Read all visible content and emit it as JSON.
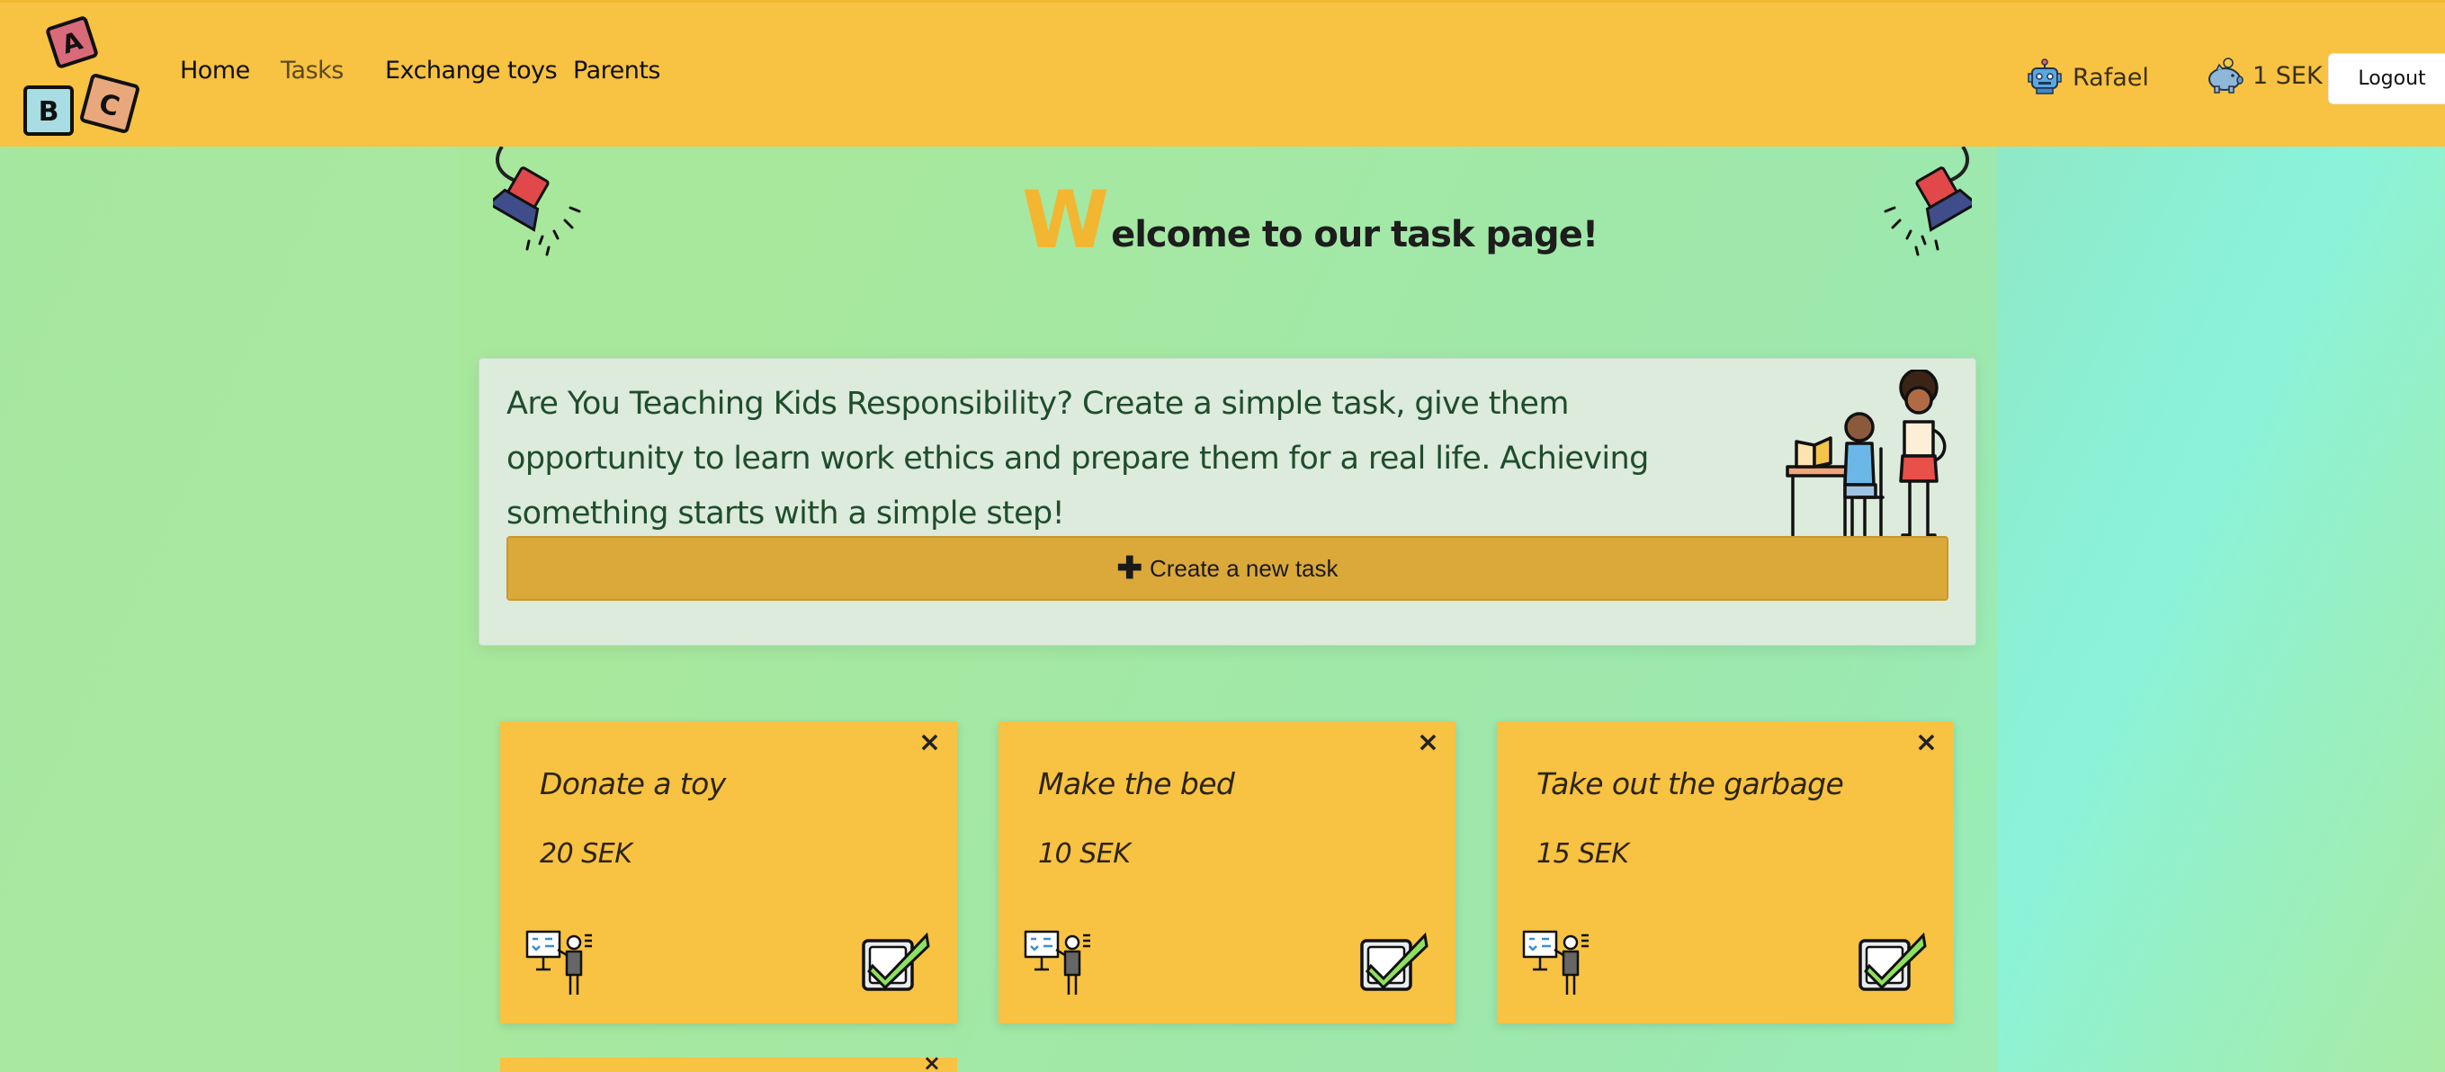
{
  "nav": {
    "logo_letters": [
      "A",
      "B",
      "C"
    ],
    "links": [
      {
        "label": "Home",
        "active": false
      },
      {
        "label": "Tasks",
        "active": true
      },
      {
        "label": "Exchange toys",
        "active": false
      },
      {
        "label": "Parents",
        "active": false
      }
    ],
    "user_icon": "robot-avatar-icon",
    "user_name": "Rafael",
    "balance_icon": "piggy-bank-icon",
    "balance": "1 SEK",
    "logout_label": "Logout"
  },
  "hero": {
    "welcome_initial": "W",
    "welcome_rest": "elcome to our task page!",
    "lamp_icon": "spotlight-icon"
  },
  "info": {
    "text": "Are You Teaching Kids Responsibility? Create a simple task, give them opportunity to learn work ethics and prepare them for a real life. Achieving something starts with a simple step!",
    "illustration": "parent-and-child-study-icon",
    "create_button_icon": "plus-icon",
    "create_button_label": "Create a new task"
  },
  "tasks": [
    {
      "title": "Donate a toy",
      "price": "20 SEK"
    },
    {
      "title": "Make the bed",
      "price": "10 SEK"
    },
    {
      "title": "Take out the garbage",
      "price": "15 SEK"
    }
  ],
  "task_icons": {
    "close": "×",
    "teacher": "teacher-board-icon",
    "complete": "checkbox-check-icon"
  },
  "colors": {
    "navbar": "#f8c242",
    "card": "#f8c242",
    "accent": "#f2b631",
    "button": "#dba93a",
    "panel": "#dcebdc"
  }
}
